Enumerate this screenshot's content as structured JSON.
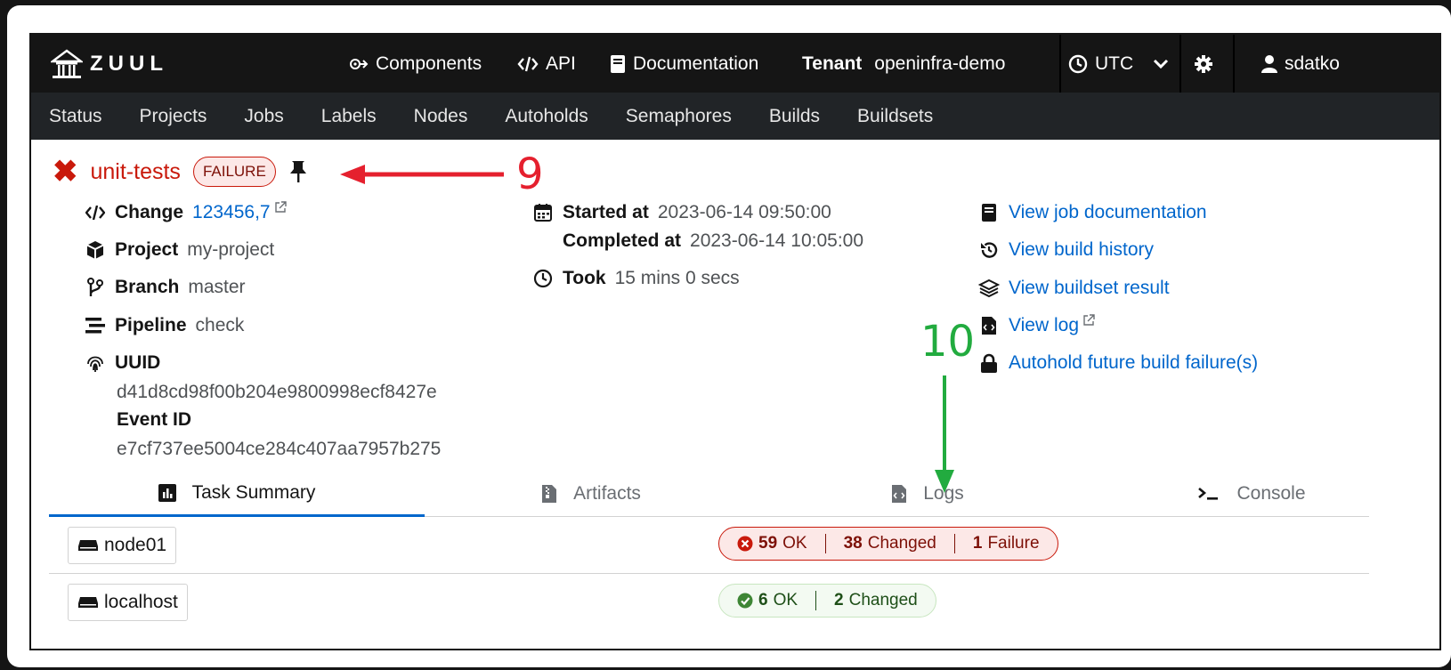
{
  "app": {
    "logo_text": "ZUUL"
  },
  "topnav": {
    "components": "Components",
    "api": "API",
    "documentation": "Documentation",
    "tenant_label": "Tenant",
    "tenant_name": "openinfra-demo",
    "timezone": "UTC",
    "user": "sdatko"
  },
  "subnav": [
    "Status",
    "Projects",
    "Jobs",
    "Labels",
    "Nodes",
    "Autoholds",
    "Semaphores",
    "Builds",
    "Buildsets"
  ],
  "build": {
    "job_name": "unit-tests",
    "result": "FAILURE",
    "change_label": "Change",
    "change_value": "123456,7",
    "project_label": "Project",
    "project_value": "my-project",
    "branch_label": "Branch",
    "branch_value": "master",
    "pipeline_label": "Pipeline",
    "pipeline_value": "check",
    "uuid_label": "UUID",
    "uuid_value": "d41d8cd98f00b204e9800998ecf8427e",
    "event_label": "Event ID",
    "event_value": "e7cf737ee5004ce284c407aa7957b275",
    "started_label": "Started at",
    "started_value": "2023-06-14 09:50:00",
    "completed_label": "Completed at",
    "completed_value": "2023-06-14 10:05:00",
    "took_label": "Took",
    "took_value": "15 mins 0 secs"
  },
  "actions": {
    "job_doc": "View job documentation",
    "history": "View build history",
    "buildset": "View buildset result",
    "log": "View log",
    "autohold": "Autohold future build failure(s)"
  },
  "tabs": [
    "Task Summary",
    "Artifacts",
    "Logs",
    "Console"
  ],
  "hosts": [
    {
      "name": "node01",
      "ok_count": "59",
      "ok_label": "OK",
      "changed_count": "38",
      "changed_label": "Changed",
      "failure_count": "1",
      "failure_label": "Failure"
    },
    {
      "name": "localhost",
      "ok_count": "6",
      "ok_label": "OK",
      "changed_count": "2",
      "changed_label": "Changed"
    }
  ],
  "annotations": {
    "nine": "9",
    "ten": "10"
  },
  "colors": {
    "danger": "#c9190b",
    "link": "#0066cc",
    "success": "#3e8635",
    "annot_red": "#e5202e",
    "annot_green": "#22ab3f"
  }
}
